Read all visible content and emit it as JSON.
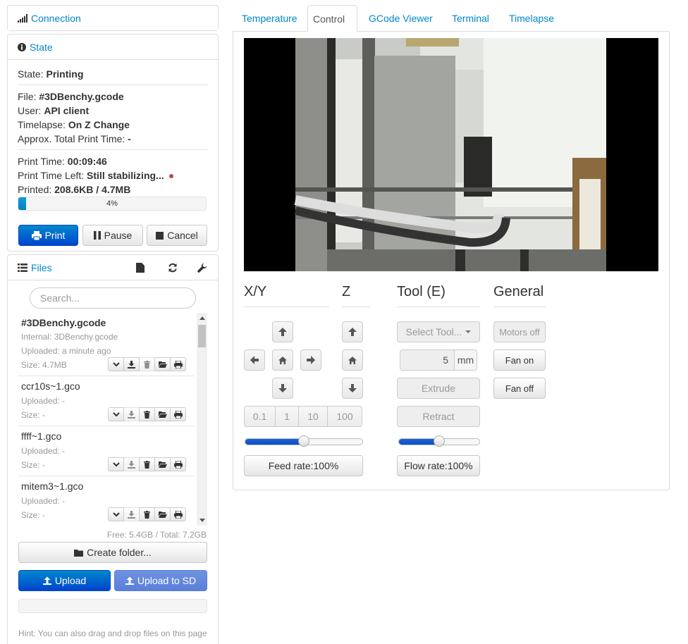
{
  "sidebar": {
    "connection": {
      "title": "Connection",
      "icon": "signal-icon"
    },
    "state": {
      "title": "State",
      "state_label": "State:",
      "state_value": "Printing",
      "file_label": "File:",
      "file_value": "#3DBenchy.gcode",
      "user_label": "User:",
      "user_value": "API client",
      "timelapse_label": "Timelapse:",
      "timelapse_value": "On Z Change",
      "total_time_label": "Approx. Total Print Time:",
      "total_time_value": "-",
      "print_time_label": "Print Time:",
      "print_time_value": "00:09:46",
      "time_left_label": "Print Time Left:",
      "time_left_value": "Still stabilizing...",
      "printed_label": "Printed:",
      "printed_value": "208.6KB / 4.7MB",
      "progress_text": "4%",
      "progress_fraction": 0.04,
      "buttons": {
        "print": "Print",
        "pause": "Pause",
        "cancel": "Cancel"
      }
    },
    "files": {
      "title": "Files",
      "search_placeholder": "Search...",
      "items": [
        {
          "name": "#3DBenchy.gcode",
          "internal": "Internal: 3DBenchy.gcode",
          "uploaded": "Uploaded: a minute ago",
          "size": "Size: 4.7MB"
        },
        {
          "name": "ccr10s~1.gco",
          "uploaded": "Uploaded: -",
          "size": "Size: -"
        },
        {
          "name": "ffff~1.gco",
          "uploaded": "Uploaded: -",
          "size": "Size: -"
        },
        {
          "name": "mitem3~1.gco",
          "uploaded": "Uploaded: -",
          "size": "Size: -"
        }
      ],
      "free_total": "Free: 5.4GB / Total: 7.2GB",
      "create_folder": "Create folder...",
      "upload": "Upload",
      "upload_sd": "Upload to SD",
      "hint": "Hint: You can also drag and drop files on this page"
    }
  },
  "tabs": [
    {
      "label": "Temperature",
      "active": false
    },
    {
      "label": "Control",
      "active": true
    },
    {
      "label": "GCode Viewer",
      "active": false
    },
    {
      "label": "Terminal",
      "active": false
    },
    {
      "label": "Timelapse",
      "active": false
    }
  ],
  "control": {
    "xy_title": "X/Y",
    "z_title": "Z",
    "tool_title": "Tool (E)",
    "general_title": "General",
    "steps": [
      "0.1",
      "1",
      "10",
      "100"
    ],
    "feed_rate_label": "Feed rate:100%",
    "feed_rate_fraction": 0.5,
    "select_tool": "Select Tool...",
    "extrude_amount": "5",
    "extrude_unit": "mm",
    "extrude": "Extrude",
    "retract": "Retract",
    "flow_rate_label": "Flow rate:100%",
    "flow_rate_fraction": 0.5,
    "motors_off": "Motors off",
    "fan_on": "Fan on",
    "fan_off": "Fan off"
  },
  "colors": {
    "link": "#0088cc",
    "primary": "#0055cc",
    "progress": "#149bdf",
    "status_dot": "#b94a48"
  }
}
